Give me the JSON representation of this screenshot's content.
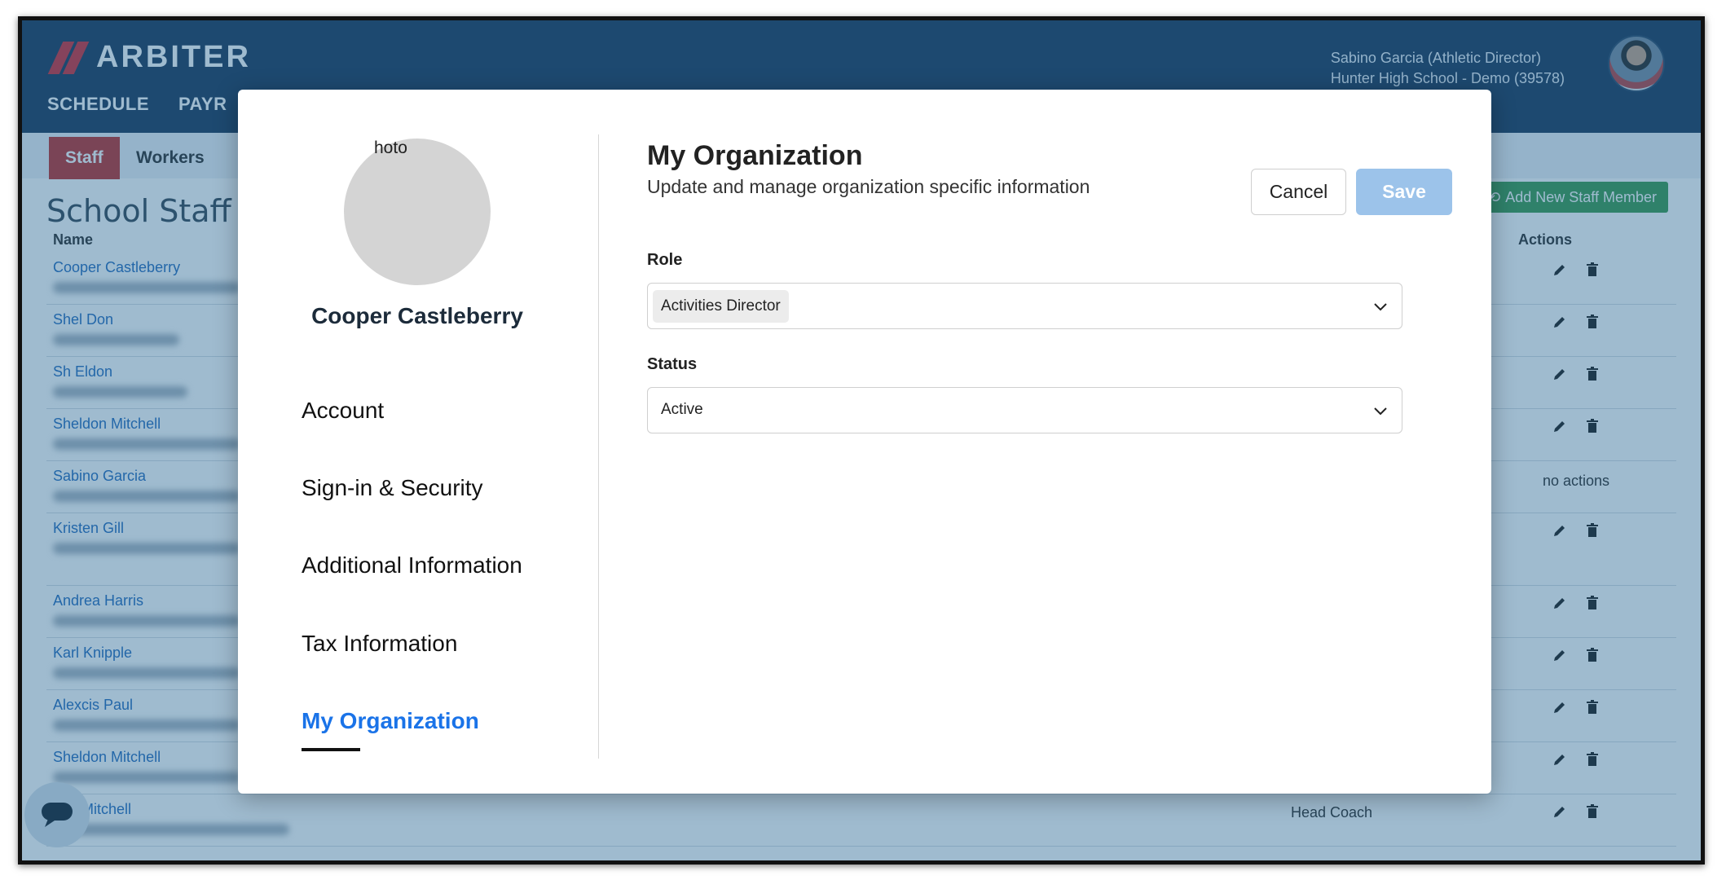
{
  "app": {
    "logo_text": "ARBITER",
    "nav": [
      "SCHEDULE",
      "PAYR"
    ],
    "user_line1": "Sabino Garcia (Athletic Director)",
    "user_line2": "Hunter High School - Demo (39578)"
  },
  "subnav": {
    "tab_staff": "Staff",
    "tab_workers": "Workers"
  },
  "page": {
    "title": "School Staff",
    "add_button": "Add New Staff Member",
    "col_name": "Name",
    "col_actions": "Actions",
    "no_actions": "no actions",
    "last_row_role": "Head Coach"
  },
  "staff_rows": [
    "Cooper Castleberry",
    "Shel Don",
    "Sh Eldon",
    "Sheldon Mitchell",
    "Sabino Garcia",
    "Kristen Gill",
    "Andrea Harris",
    "Karl Knipple",
    "Alexcis Paul",
    "Sheldon Mitchell",
    "don Mitchell"
  ],
  "modal": {
    "photo_alt": "hoto",
    "profile_name": "Cooper Castleberry",
    "menu": {
      "account": "Account",
      "security": "Sign-in & Security",
      "additional": "Additional Information",
      "tax": "Tax Information",
      "organization": "My Organization"
    },
    "section_title": "My Organization",
    "section_subtitle": "Update and manage organization specific information",
    "cancel_label": "Cancel",
    "save_label": "Save",
    "role_label": "Role",
    "role_value": "Activities Director",
    "status_label": "Status",
    "status_value": "Active"
  },
  "colors": {
    "header": "#1f3b5c",
    "accent_red": "#c0322f",
    "link_blue": "#2a6ebd",
    "active_menu": "#1a73e8",
    "save_disabled": "#9cc3ea",
    "add_green": "#3e9b52"
  },
  "icons": [
    "edit-icon",
    "trash-icon",
    "chevron-down-icon",
    "chat-icon",
    "refresh-icon"
  ]
}
